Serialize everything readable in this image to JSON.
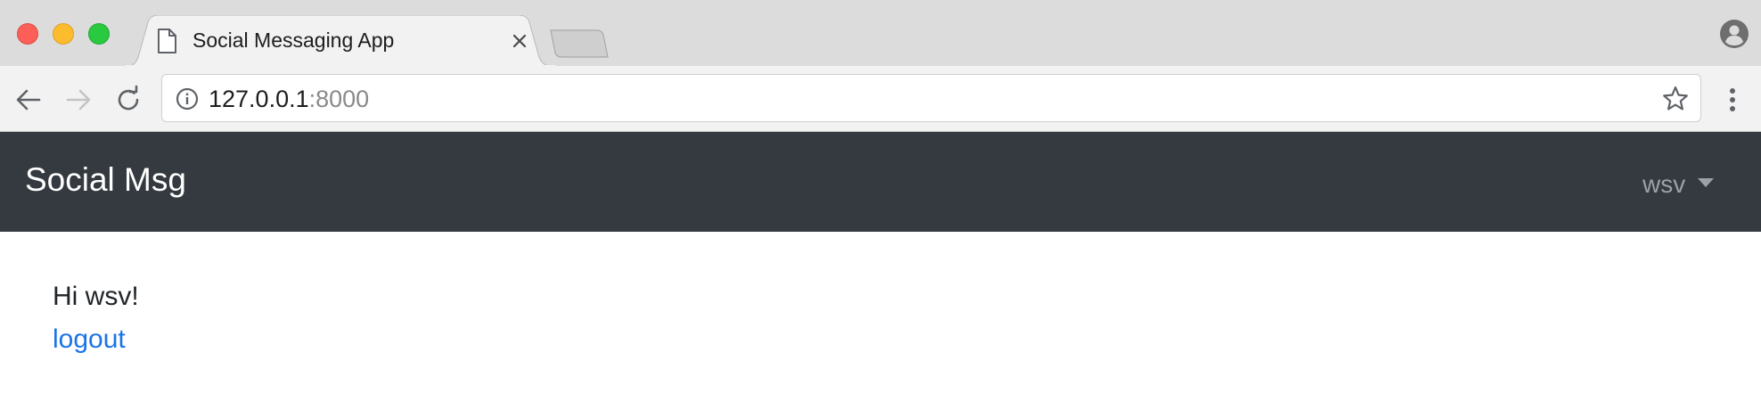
{
  "browser": {
    "tab": {
      "title": "Social Messaging App",
      "icon": "document-icon"
    },
    "address_bar": {
      "host": "127.0.0.1",
      "port": ":8000"
    },
    "icons": {
      "back": "arrow-left-icon",
      "forward": "arrow-right-icon",
      "reload": "reload-icon",
      "info": "info-icon",
      "bookmark": "star-icon",
      "menu": "vertical-dots-icon",
      "profile": "account-icon",
      "close_tab": "close-icon"
    },
    "colors": {
      "traffic_red": "#fc5f57",
      "traffic_yellow": "#fdbc2e",
      "traffic_green": "#29c940"
    }
  },
  "page": {
    "navbar": {
      "brand": "Social Msg",
      "user": "wsv",
      "background": "#343a40"
    },
    "main": {
      "greeting": "Hi wsv!",
      "logout_label": "logout",
      "link_color": "#1a73e8"
    }
  }
}
